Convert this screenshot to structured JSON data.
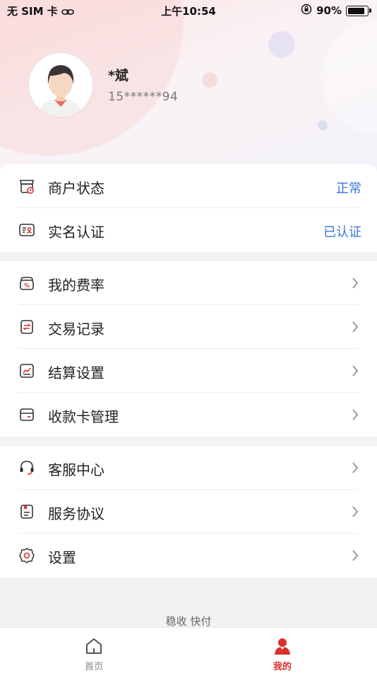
{
  "status_bar": {
    "carrier": "无 SIM 卡",
    "time": "上午10:54",
    "battery": "90%"
  },
  "profile": {
    "name": "*斌",
    "phone": "15******94"
  },
  "section_status": [
    {
      "label": "商户状态",
      "value": "正常",
      "icon": "shop-icon"
    },
    {
      "label": "实名认证",
      "value": "已认证",
      "icon": "id-card-icon"
    }
  ],
  "section_business": [
    {
      "label": "我的费率",
      "icon": "rate-icon"
    },
    {
      "label": "交易记录",
      "icon": "transaction-icon"
    },
    {
      "label": "结算设置",
      "icon": "settlement-icon"
    },
    {
      "label": "收款卡管理",
      "icon": "bank-card-icon"
    }
  ],
  "section_support": [
    {
      "label": "客服中心",
      "icon": "headset-icon"
    },
    {
      "label": "服务协议",
      "icon": "document-icon"
    },
    {
      "label": "设置",
      "icon": "gear-icon"
    }
  ],
  "footer": {
    "brand": "稳收 快付"
  },
  "tabbar": {
    "home_label": "首页",
    "mine_label": "我的"
  },
  "colors": {
    "accent_red": "#d9302c",
    "value_blue": "#3b74d9"
  }
}
